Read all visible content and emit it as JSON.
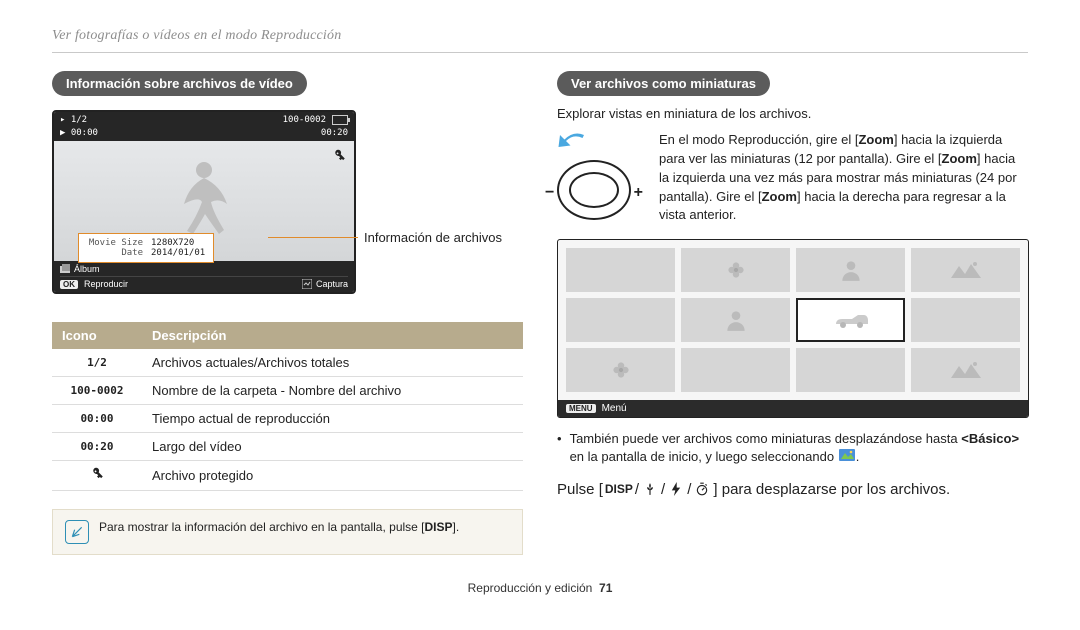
{
  "breadcrumb": "Ver fotografías o vídeos en el modo Reproducción",
  "left": {
    "heading": "Información sobre archivos de vídeo",
    "callout": "Información de archivos",
    "lcd": {
      "counter": "1/2",
      "file": "100-0002",
      "time_current": "00:00",
      "time_total": "00:20",
      "popup": {
        "movie_size_label": "Movie Size",
        "movie_size_value": "1280X720",
        "date_label": "Date",
        "date_value": "2014/01/01"
      },
      "album": "Álbum",
      "ok_label": "OK",
      "play": "Reproducir",
      "capture": "Captura"
    },
    "table": {
      "h1": "Icono",
      "h2": "Descripción",
      "rows": [
        {
          "icon": "1/2",
          "desc": "Archivos actuales/Archivos totales"
        },
        {
          "icon": "100-0002",
          "desc": "Nombre de la carpeta - Nombre del archivo"
        },
        {
          "icon": "00:00",
          "desc": "Tiempo actual de reproducción"
        },
        {
          "icon": "00:20",
          "desc": "Largo del vídeo"
        },
        {
          "icon": "key",
          "desc": "Archivo protegido"
        }
      ]
    },
    "note": {
      "text_a": "Para mostrar la información del archivo en la pantalla, pulse [",
      "disp": "DISP",
      "text_b": "]."
    }
  },
  "right": {
    "heading": "Ver archivos como miniaturas",
    "sub": "Explorar vistas en miniatura de los archivos.",
    "zoom": {
      "a": "En el modo Reproducción, gire el [",
      "z": "Zoom",
      "b": "] hacia la izquierda para ver las miniaturas (12 por pantalla). Gire el [",
      "c": "] hacia la izquierda una vez más para mostrar más miniaturas (24 por pantalla). Gire el [",
      "d": "] hacia la derecha para regresar a la vista anterior."
    },
    "menu_label": "MENU",
    "menu_text": "Menú",
    "bullet": {
      "a": "También puede ver archivos como miniaturas desplazándose hasta ",
      "basico": "<Básico>",
      "b": " en la pantalla de inicio, y luego seleccionando ",
      "c": "."
    },
    "pulse": {
      "a": "Pulse [",
      "disp": "DISP",
      "b": "] para desplazarse por los archivos."
    }
  },
  "footer": {
    "section": "Reproducción y edición",
    "page": "71"
  }
}
